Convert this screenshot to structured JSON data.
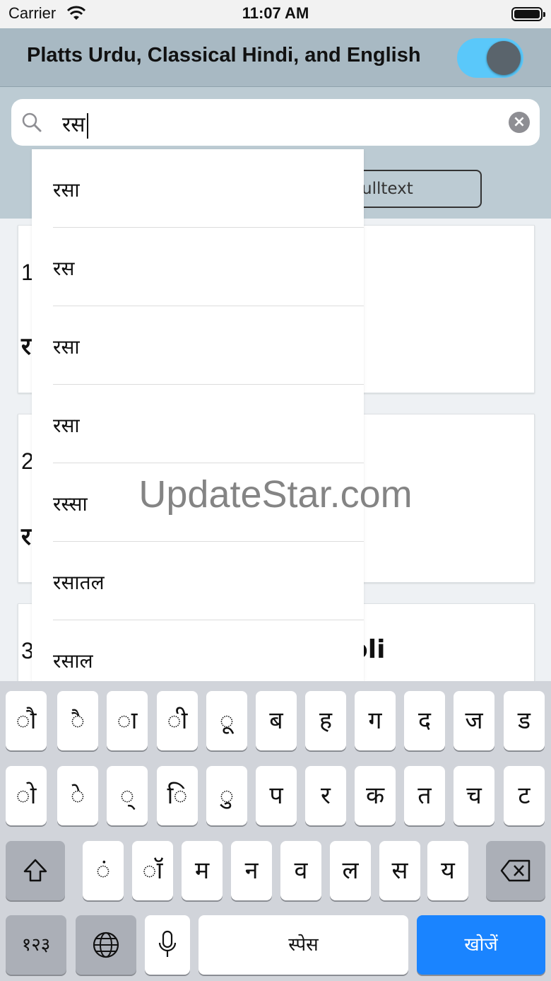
{
  "status": {
    "carrier": "Carrier",
    "time": "11:07 AM"
  },
  "header": {
    "title": "Platts Urdu, Classical Hindi, and English"
  },
  "search": {
    "value": "रस",
    "fulltext_label": "ulltext"
  },
  "results": [
    {
      "num": "1",
      "word": "र",
      "tail": ""
    },
    {
      "num": "2",
      "word": "र",
      "tail": ""
    },
    {
      "num": "3",
      "word": "",
      "tail": "oli"
    }
  ],
  "suggestions": [
    "रसा",
    "रस",
    "रसा",
    "रसा",
    "रस्सा",
    "रसातल",
    "रसाल"
  ],
  "watermark": "UpdateStar.com",
  "keyboard": {
    "row1": [
      "ौ",
      "ै",
      "ा",
      "ी",
      "ू",
      "ब",
      "ह",
      "ग",
      "द",
      "ज",
      "ड"
    ],
    "row2": [
      "ो",
      "े",
      "्",
      "ि",
      "ु",
      "प",
      "र",
      "क",
      "त",
      "च",
      "ट"
    ],
    "row3": [
      "ं",
      "ॉ",
      "म",
      "न",
      "व",
      "ल",
      "स",
      "य"
    ],
    "numbers": "१२३",
    "space": "स्पेस",
    "search": "खोजें"
  },
  "colors": {
    "toggle_on": "#5ac8fa",
    "search_key": "#1a84ff",
    "header": "#a8b9c3"
  }
}
